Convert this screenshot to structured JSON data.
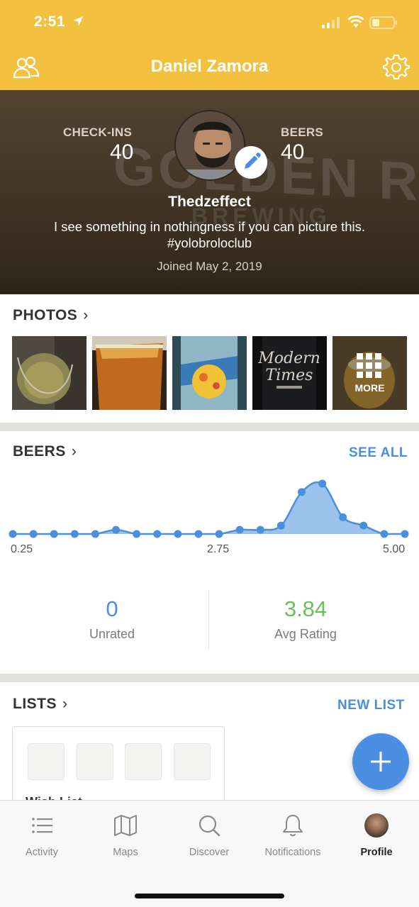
{
  "status": {
    "time": "2:51"
  },
  "header": {
    "title": "Daniel Zamora",
    "friends_icon": "friends-icon",
    "settings_icon": "gear-icon",
    "background": "#f4c040"
  },
  "profile": {
    "checkins_label": "CHECK-INS",
    "checkins_value": "40",
    "beers_label": "BEERS",
    "beers_value": "40",
    "username": "Thedzeffect",
    "bio": "I see something in nothingness if you can picture this. #yolobroloclub",
    "joined": "Joined May 2, 2019",
    "edit_icon": "pencil-icon"
  },
  "photos": {
    "title": "PHOTOS",
    "more_label": "MORE",
    "items": [
      "photo-1",
      "photo-2",
      "photo-3",
      "photo-4",
      "photo-5"
    ]
  },
  "beers": {
    "title": "BEERS",
    "see_all": "SEE ALL",
    "ticks": [
      "0.25",
      "2.75",
      "5.00"
    ],
    "unrated_value": "0",
    "unrated_label": "Unrated",
    "avg_value": "3.84",
    "avg_label": "Avg Rating",
    "avg_color": "#6bbf59",
    "unrated_color": "#4a8fdc"
  },
  "chart_data": {
    "type": "area",
    "x": [
      0.25,
      0.5,
      0.75,
      1.0,
      1.25,
      1.5,
      1.75,
      2.0,
      2.25,
      2.5,
      2.75,
      3.0,
      3.25,
      3.5,
      3.75,
      4.0,
      4.25,
      4.5,
      4.75,
      5.0
    ],
    "values": [
      0,
      0,
      0,
      0,
      0,
      1,
      0,
      0,
      0,
      0,
      0,
      1,
      1,
      2,
      10,
      12,
      4,
      2,
      0,
      0
    ],
    "xlim": [
      0.25,
      5.0
    ],
    "x_tick_labels": [
      "0.25",
      "2.75",
      "5.00"
    ],
    "color": "#4a8fdc"
  },
  "lists": {
    "title": "LISTS",
    "new_list": "NEW LIST",
    "card_title": "Wish List"
  },
  "tabs": [
    {
      "label": "Activity",
      "icon": "list-icon"
    },
    {
      "label": "Maps",
      "icon": "map-icon"
    },
    {
      "label": "Discover",
      "icon": "search-icon"
    },
    {
      "label": "Notifications",
      "icon": "bell-icon"
    },
    {
      "label": "Profile",
      "icon": "avatar"
    }
  ]
}
